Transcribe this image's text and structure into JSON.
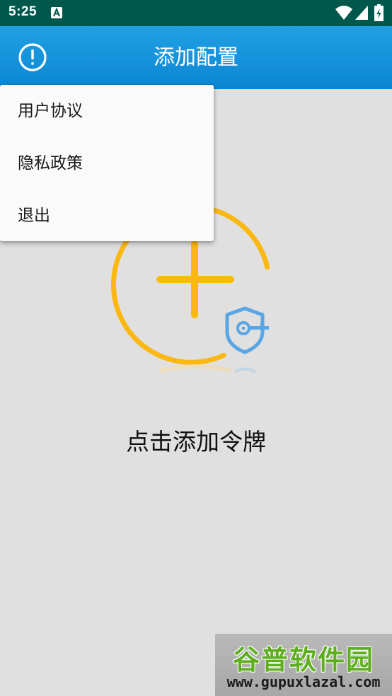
{
  "status_bar": {
    "time": "5:25",
    "icons": [
      "a-notification-icon",
      "wifi-icon",
      "signal-icon",
      "battery-icon"
    ],
    "background": "#00574b"
  },
  "app_bar": {
    "title": "添加配置",
    "icons": [
      "info-icon"
    ],
    "color": "#0a86d2"
  },
  "menu": {
    "items": [
      {
        "label": "用户协议"
      },
      {
        "label": "隐私政策"
      },
      {
        "label": "退出"
      }
    ]
  },
  "main": {
    "add_token_label": "点击添加令牌",
    "graphic_icons": [
      "add-circle-icon",
      "shield-key-icon"
    ],
    "accent_color": "#fbb812",
    "shield_color": "#58a6e6"
  },
  "watermark": {
    "logo": "谷普软件园",
    "url": "www.gupuxlazal.com"
  }
}
